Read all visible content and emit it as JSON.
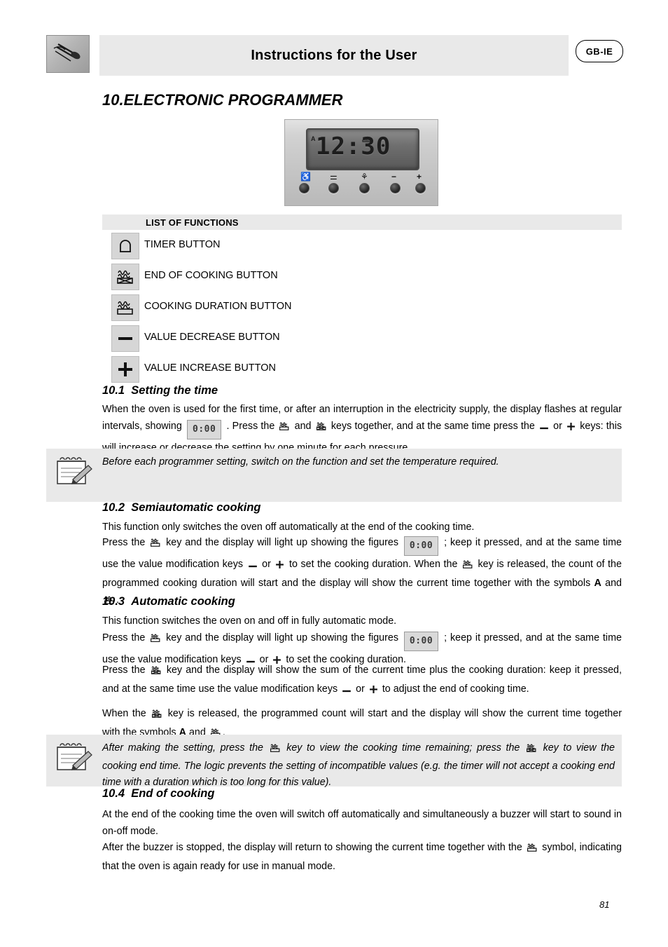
{
  "header": {
    "title": "Instructions for the User",
    "language_badge": "GB-IE",
    "logo_icon": "whisk-utensils-icon"
  },
  "section": {
    "number": "10.",
    "title": "ELECTRONIC PROGRAMMER"
  },
  "programmer": {
    "display_value": "12:30",
    "display_auto_label": "A",
    "icons": [
      "bell-icon",
      "pan-icon",
      "end-cooking-icon",
      "minus-icon",
      "plus-icon"
    ]
  },
  "functions_table": {
    "header": "LIST OF FUNCTIONS",
    "rows": [
      {
        "icon": "bell-icon",
        "label": "TIMER BUTTON"
      },
      {
        "icon": "end-of-cooking-icon",
        "label": "END OF COOKING BUTTON"
      },
      {
        "icon": "cooking-duration-icon",
        "label": "COOKING DURATION BUTTON"
      },
      {
        "icon": "minus-icon",
        "label": "VALUE DECREASE BUTTON"
      },
      {
        "icon": "plus-icon",
        "label": "VALUE INCREASE BUTTON"
      }
    ]
  },
  "s1": {
    "num": "10.1",
    "title": "Setting the time",
    "p1_a": "When the oven is used for the first time, or after an interruption in the electricity supply, the display flashes at regular intervals, showing",
    "p1_chip": "0:00",
    "p1_b": ". Press the",
    "p1_c": "and",
    "p1_d": "keys together, and at the same time press the",
    "p1_e": "or",
    "p1_f": "keys: this will increase or decrease the setting by one minute for each pressure.",
    "note": "Before each programmer setting, switch on the function and set the temperature required."
  },
  "s2": {
    "num": "10.2",
    "title": "Semiautomatic cooking",
    "p1": "This function only switches the oven off automatically at the end of the cooking time.",
    "p2_a": "Press the",
    "p2_b": "key and the display will light up showing the figures",
    "p2_chip": "0:00",
    "p2_c": "; keep it pressed, and at the same time use the value modification keys",
    "p2_d": "or",
    "p2_e": "to set the cooking duration. When the",
    "p2_f": "key is released, the count of the programmed cooking duration will start and the display will show the current time together with the symbols",
    "p2_bold": "A",
    "p2_g": "and",
    "p2_h": "."
  },
  "s3": {
    "num": "10.3",
    "title": "Automatic cooking",
    "p1": "This function switches the oven on and off in fully automatic mode.",
    "p2_a": "Press the",
    "p2_b": "key and the display will light up showing the figures",
    "p2_chip": "0:00",
    "p2_c": "; keep it pressed, and at the same time use the value modification keys",
    "p2_d": "or",
    "p2_e": "to set the cooking duration.",
    "p3_a": "Press the",
    "p3_b": "key and the display will show the sum of the current time plus the cooking duration: keep it pressed, and at the same time use the value modification keys",
    "p3_c": "or",
    "p3_d": "to adjust the end of cooking time.",
    "p4_a": "When the",
    "p4_b": "key is released, the programmed count will start and the display will show the current time together with the symbols",
    "p4_bold": "A",
    "p4_c": "and",
    "p4_d": ".",
    "note_a": "After making the setting, press the",
    "note_b": "key to view the cooking time remaining; press the",
    "note_c": "key to view the cooking end time. The logic prevents the setting of incompatible values (e.g. the timer will not accept a cooking end time with a duration which is too long for this value)."
  },
  "s4": {
    "num": "10.4",
    "title": "End of cooking",
    "p1": "At the end of the cooking time the oven will switch off automatically and simultaneously a buzzer will start to sound in on-off mode.",
    "p2_a": "After the buzzer is stopped, the display will return to showing the current time together with the",
    "p2_b": "symbol, indicating that the oven is again ready for use in manual mode."
  },
  "footer": {
    "page_number": "81"
  }
}
